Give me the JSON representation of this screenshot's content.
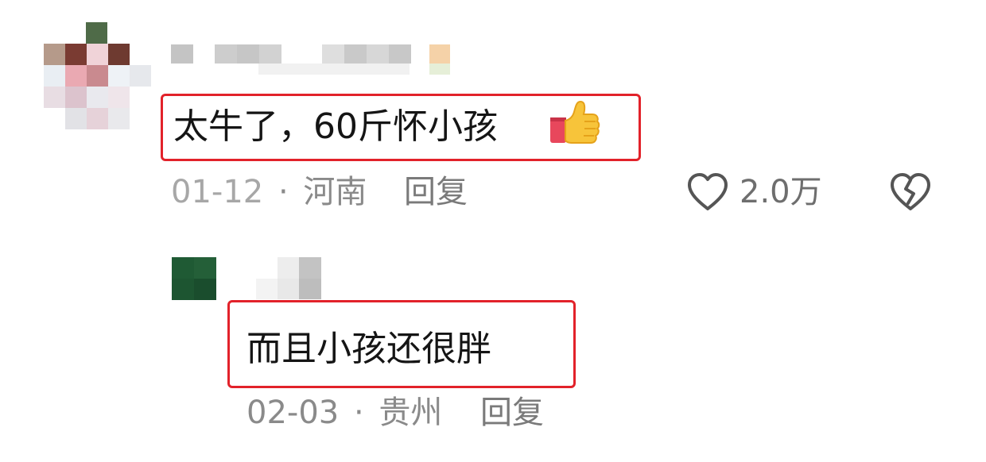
{
  "comments": [
    {
      "text": "太牛了，60斤怀小孩",
      "emoji": "👍",
      "date": "01-12",
      "separator": "·",
      "location": "河南",
      "reply_label": "回复",
      "like_count": "2.0万",
      "icons": {
        "like": "heart-outline-icon",
        "dislike": "broken-heart-icon",
        "emoji": "thumbs-up-icon"
      }
    }
  ],
  "replies": [
    {
      "text": "而且小孩还很胖",
      "date": "02-03",
      "separator": "·",
      "location": "贵州",
      "reply_label": "回复"
    }
  ],
  "colors": {
    "highlight_border": "#e2222a",
    "meta_text": "#8a8a8a",
    "icon_stroke": "#555555"
  }
}
